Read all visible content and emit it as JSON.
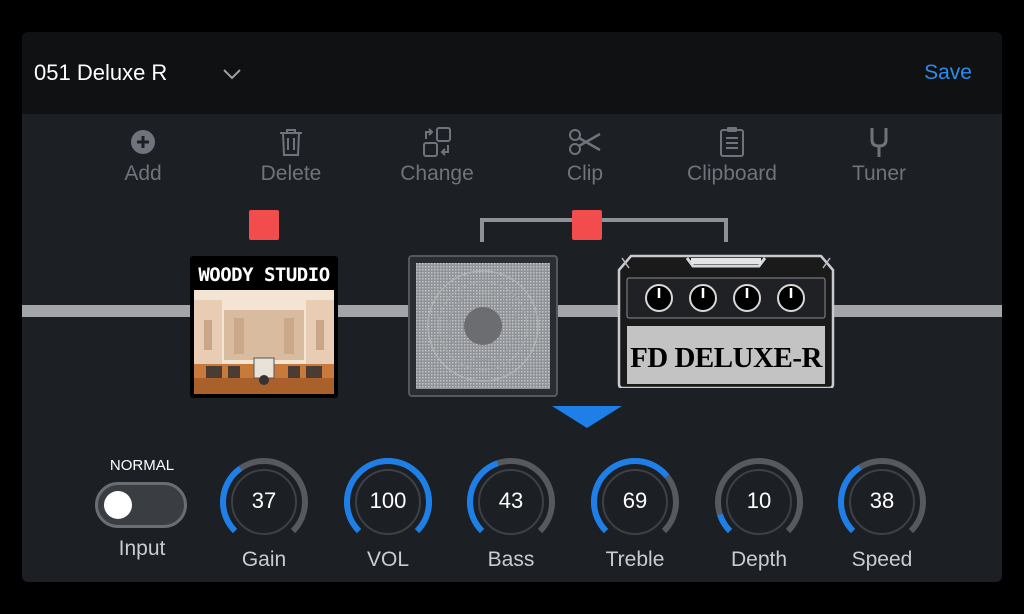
{
  "header": {
    "preset_name": "051 Deluxe R",
    "save_label": "Save"
  },
  "toolbar": [
    {
      "label": "Add",
      "icon": "plus-circle-icon"
    },
    {
      "label": "Delete",
      "icon": "trash-icon"
    },
    {
      "label": "Change",
      "icon": "swap-icon"
    },
    {
      "label": "Clip",
      "icon": "scissors-icon"
    },
    {
      "label": "Clipboard",
      "icon": "clipboard-icon"
    },
    {
      "label": "Tuner",
      "icon": "tuning-fork-icon"
    }
  ],
  "chain": {
    "ir_block_title": "WOODY STUDIO",
    "amp_label": "FD DELUXE-R"
  },
  "controls": {
    "input_mode": "NORMAL",
    "input_label": "Input",
    "knobs": [
      {
        "label": "Gain",
        "value": "37",
        "fraction": 0.37
      },
      {
        "label": "VOL",
        "value": "100",
        "fraction": 1.0
      },
      {
        "label": "Bass",
        "value": "43",
        "fraction": 0.43
      },
      {
        "label": "Treble",
        "value": "69",
        "fraction": 0.69
      },
      {
        "label": "Depth",
        "value": "10",
        "fraction": 0.1
      },
      {
        "label": "Speed",
        "value": "38",
        "fraction": 0.38
      }
    ]
  },
  "colors": {
    "accent": "#2b8cf0",
    "block_marker": "#f24c4c",
    "knob_track": "#56595e",
    "knob_fill": "#1e7fe8"
  }
}
